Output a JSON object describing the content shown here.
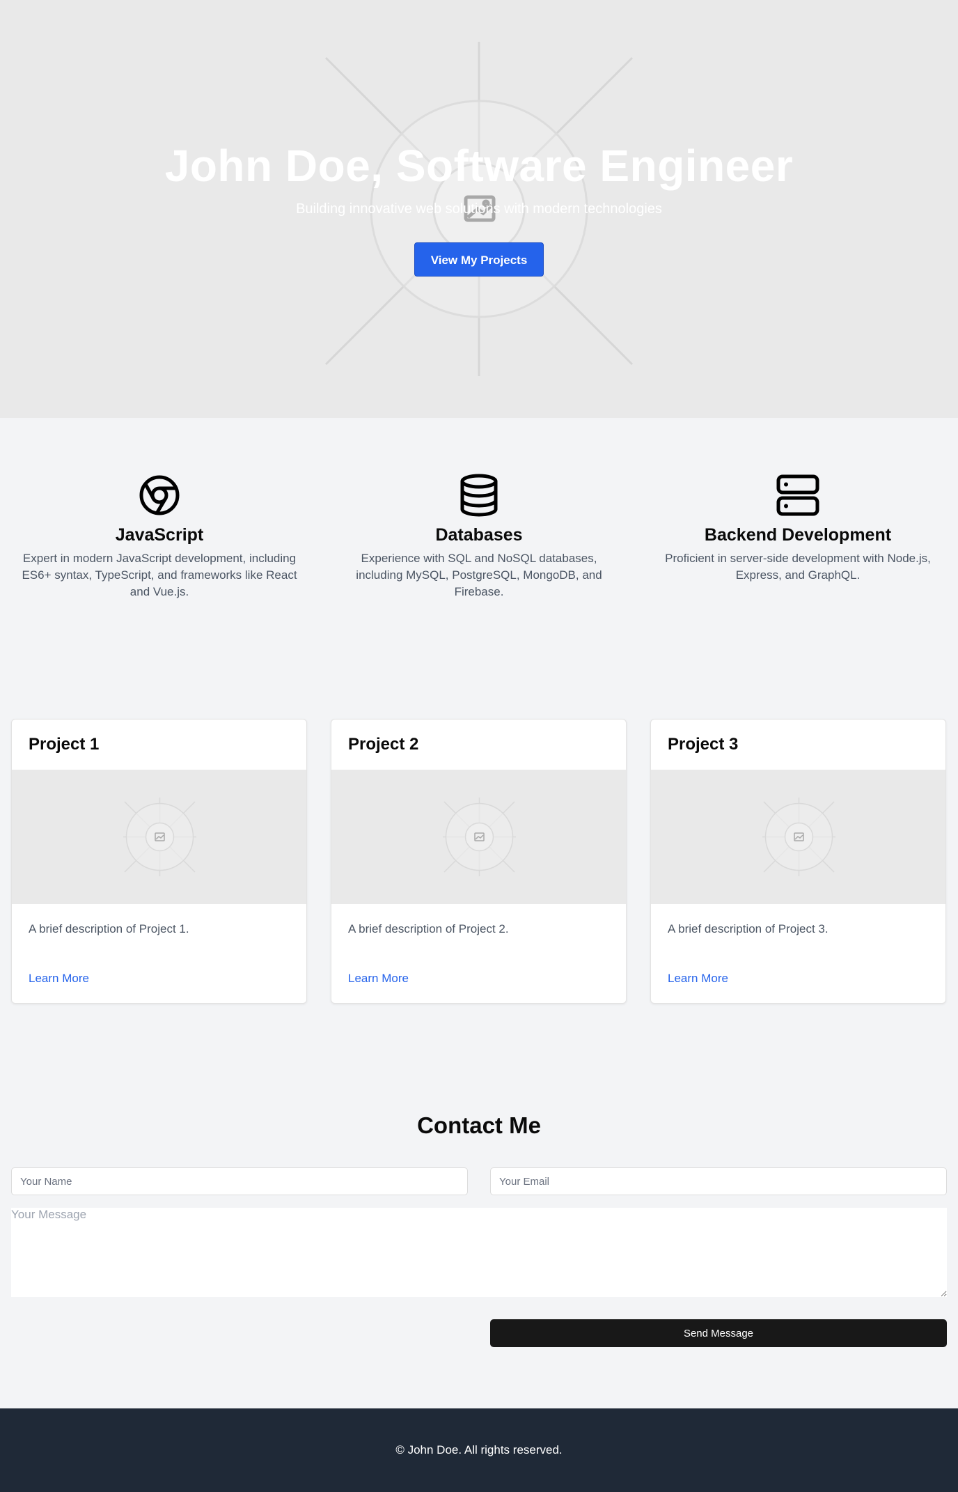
{
  "hero": {
    "title": "John Doe, Software Engineer",
    "subtitle": "Building innovative web solutions with modern technologies",
    "cta_label": "View My Projects",
    "bg_icon": "image-placeholder-icon"
  },
  "skills": [
    {
      "icon": "chrome-icon",
      "title": "JavaScript",
      "description": "Expert in modern JavaScript development, including ES6+ syntax, TypeScript, and frameworks like React and Vue.js."
    },
    {
      "icon": "database-icon",
      "title": "Databases",
      "description": "Experience with SQL and NoSQL databases, including MySQL, PostgreSQL, MongoDB, and Firebase."
    },
    {
      "icon": "server-icon",
      "title": "Backend Development",
      "description": "Proficient in server-side development with Node.js, Express, and GraphQL."
    }
  ],
  "projects": [
    {
      "title": "Project 1",
      "description": "A brief description of Project 1.",
      "link_label": "Learn More"
    },
    {
      "title": "Project 2",
      "description": "A brief description of Project 2.",
      "link_label": "Learn More"
    },
    {
      "title": "Project 3",
      "description": "A brief description of Project 3.",
      "link_label": "Learn More"
    }
  ],
  "contact": {
    "title": "Contact Me",
    "name_placeholder": "Your Name",
    "email_placeholder": "Your Email",
    "message_placeholder": "Your Message",
    "send_label": "Send Message"
  },
  "footer": {
    "copyright": "© John Doe. All rights reserved."
  },
  "colors": {
    "accent": "#2563eb",
    "footer_bg": "#1f2937",
    "send_button": "#181818"
  }
}
